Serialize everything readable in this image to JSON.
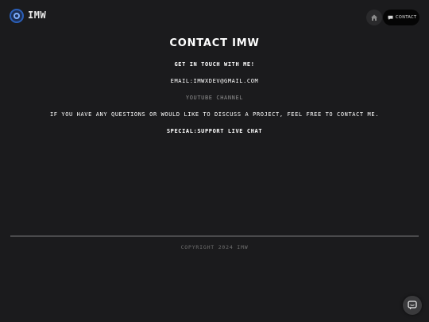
{
  "header": {
    "brand": "IMW",
    "nav": {
      "home_icon": "home-icon",
      "contact_icon": "chat-icon",
      "contact_label": "CONTACT"
    }
  },
  "main": {
    "title": "CONTACT IMW",
    "subtitle": "GET IN TOUCH WITH ME!",
    "email": "EMAIL:IMWXDEV@GMAIL.COM",
    "youtube": "YOUTUBE CHANNEL",
    "description": "IF YOU HAVE ANY QUESTIONS OR WOULD LIKE TO DISCUSS A PROJECT, FEEL FREE TO CONTACT ME.",
    "special": "SPECIAL:SUPPORT LIVE CHAT"
  },
  "footer": {
    "copyright": "COPYRIGHT 2024 IMW"
  },
  "chat_widget": {
    "icon": "chat-bubble-icon"
  },
  "colors": {
    "background": "#1b1b1d",
    "accent": "#2b5fb8",
    "muted_text": "#8c8c8c"
  }
}
